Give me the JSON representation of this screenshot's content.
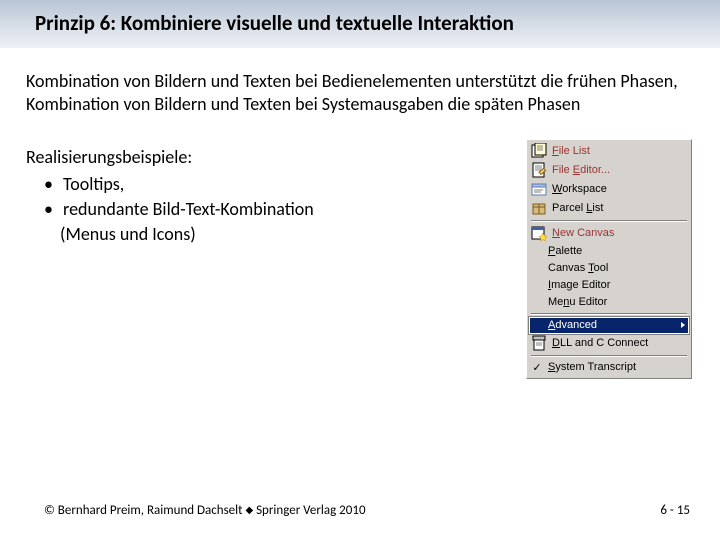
{
  "title": "Prinzip 6: Kombiniere visuelle und textuelle Interaktion",
  "intro": "Kombination von Bildern und Texten bei Bedienelementen unterstützt die frühen Phasen, Kombination von Bildern und Texten bei Systemausgaben die späten Phasen",
  "examples": {
    "heading": "Realisierungsbeispiele:",
    "items": [
      "Tooltips,",
      "redundante Bild-Text-Kombination"
    ],
    "note": "(Menus und Icons)"
  },
  "menu": {
    "items": [
      {
        "label_pre": "",
        "mn": "F",
        "label_post": "ile List",
        "icon": "file-list",
        "accent": true,
        "arrow": false
      },
      {
        "label_pre": "File ",
        "mn": "E",
        "label_post": "ditor...",
        "icon": "file-editor",
        "accent": true,
        "arrow": false
      },
      {
        "label_pre": "",
        "mn": "W",
        "label_post": "orkspace",
        "icon": "workspace",
        "accent": false,
        "arrow": false
      },
      {
        "label_pre": "Parcel ",
        "mn": "L",
        "label_post": "ist",
        "icon": "parcel",
        "accent": false,
        "arrow": false
      },
      "sep",
      {
        "label_pre": "",
        "mn": "N",
        "label_post": "ew Canvas",
        "icon": "new-canvas",
        "accent": true,
        "arrow": false
      },
      {
        "label_pre": "",
        "mn": "P",
        "label_post": "alette",
        "icon": "none",
        "accent": false,
        "arrow": false
      },
      {
        "label_pre": "Canvas ",
        "mn": "T",
        "label_post": "ool",
        "icon": "none",
        "accent": false,
        "arrow": false
      },
      {
        "label_pre": "",
        "mn": "I",
        "label_post": "mage Editor",
        "icon": "none",
        "accent": false,
        "arrow": false
      },
      {
        "label_pre": "Me",
        "mn": "n",
        "label_post": "u Editor",
        "icon": "none",
        "accent": false,
        "arrow": false
      },
      "sep",
      {
        "label_pre": "",
        "mn": "A",
        "label_post": "dvanced",
        "icon": "none",
        "accent": false,
        "arrow": true,
        "hover": true
      },
      {
        "label_pre": "",
        "mn": "D",
        "label_post": "LL and C Connect",
        "icon": "dll",
        "accent": false,
        "arrow": false
      },
      "sep",
      {
        "label_pre": "",
        "mn": "S",
        "label_post": "ystem Transcript",
        "icon": "none",
        "accent": false,
        "arrow": false,
        "checked": true
      }
    ]
  },
  "footer": {
    "copyright_pre": "© Bernhard Preim, Raimund Dachselt ",
    "copyright_post": " Springer Verlag 2010",
    "page": "6 - 15"
  }
}
